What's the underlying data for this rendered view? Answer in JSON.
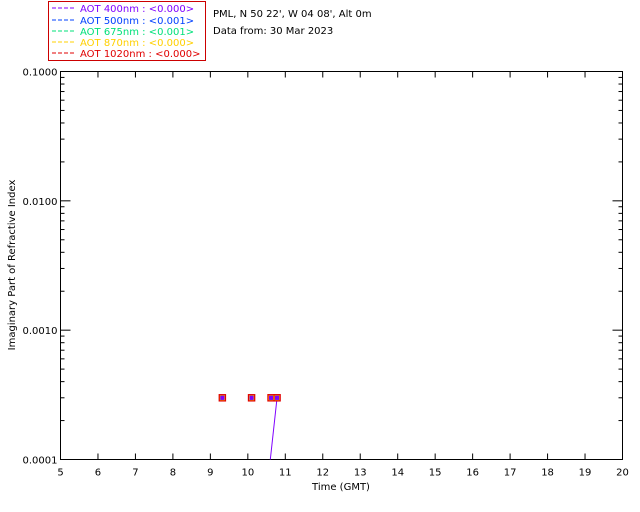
{
  "legend": {
    "entries": [
      {
        "label": "AOT  400nm : <0.000>",
        "color": "#7f00ff"
      },
      {
        "label": "AOT  500nm : <0.001>",
        "color": "#0040ff"
      },
      {
        "label": "AOT  675nm : <0.001>",
        "color": "#00e07a"
      },
      {
        "label": "AOT  870nm : <0.000>",
        "color": "#ffd000"
      },
      {
        "label": "AOT 1020nm : <0.000>",
        "color": "#e00000"
      }
    ]
  },
  "header": {
    "site": "PML, N 50 22', W 04 08', Alt 0m",
    "date": "Data from: 30 Mar 2023"
  },
  "chart_data": {
    "type": "line",
    "xlabel": "Time (GMT)",
    "ylabel": "Imaginary Part of Refractive Index",
    "xlim": [
      5,
      20
    ],
    "ylim": [
      0.0001,
      0.1
    ],
    "yscale": "log",
    "x_ticks": [
      "5",
      "6",
      "7",
      "8",
      "9",
      "10",
      "11",
      "12",
      "13",
      "14",
      "15",
      "16",
      "17",
      "18",
      "19",
      "20"
    ],
    "y_ticks": [
      {
        "value": 0.0001,
        "label": "0.0001"
      },
      {
        "value": 0.001,
        "label": "0.0010"
      },
      {
        "value": 0.01,
        "label": "0.0100"
      },
      {
        "value": 0.1,
        "label": "0.1000"
      }
    ],
    "series": [
      {
        "name": "AOT  400nm : <0.000>",
        "color": "#7f00ff",
        "x": [
          9.32,
          10.1,
          10.62,
          10.78
        ],
        "y": [
          0.0003,
          0.0003,
          0.0003,
          0.0003
        ]
      },
      {
        "name": "AOT  500nm : <0.001>",
        "color": "#0040ff",
        "x": [
          9.32,
          10.1,
          10.62,
          10.78
        ],
        "y": [
          0.0003,
          0.0003,
          0.0003,
          0.0003
        ]
      },
      {
        "name": "AOT  675nm : <0.001>",
        "color": "#00e07a",
        "x": [
          9.32,
          10.1,
          10.62,
          10.78
        ],
        "y": [
          0.0003,
          0.0003,
          0.0003,
          0.0003
        ]
      },
      {
        "name": "AOT  870nm : <0.000>",
        "color": "#ffd000",
        "x": [
          9.32,
          10.1,
          10.62,
          10.78
        ],
        "y": [
          0.0003,
          0.0003,
          0.0003,
          0.0003
        ]
      },
      {
        "name": "AOT 1020nm : <0.000>",
        "color": "#e00000",
        "x": [
          9.32,
          10.1,
          10.62,
          10.78
        ],
        "y": [
          0.0003,
          0.0003,
          0.0003,
          0.0003
        ]
      }
    ],
    "trend_line": {
      "color": "#7f00ff",
      "x": [
        10.6,
        10.78
      ],
      "y": [
        0.0001,
        0.0003
      ]
    }
  }
}
